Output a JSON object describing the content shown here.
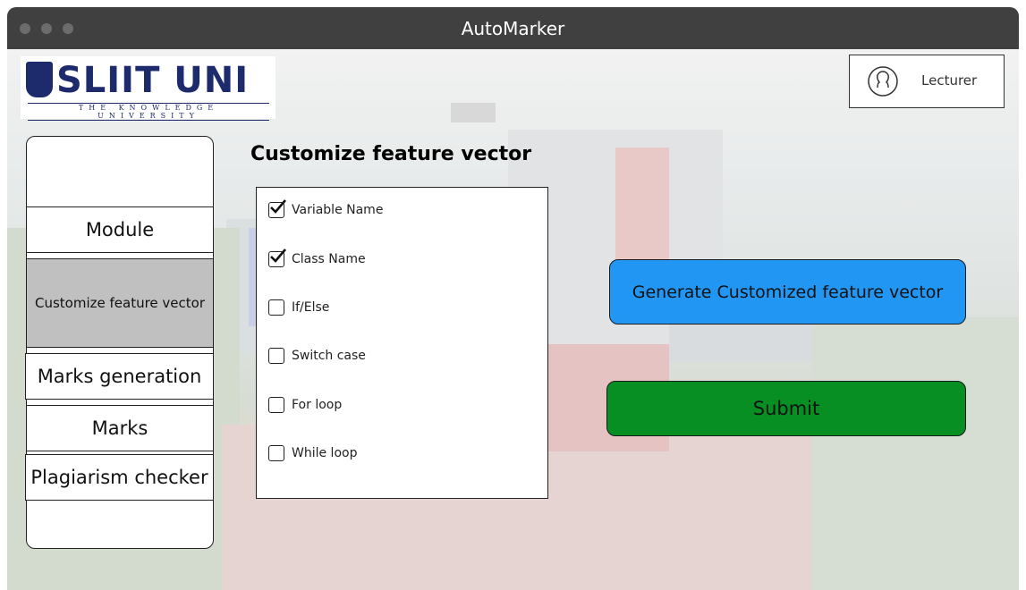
{
  "window": {
    "title": "AutoMarker"
  },
  "logo": {
    "name": "SLIIT UNI",
    "tagline": "THE KNOWLEDGE UNIVERSITY"
  },
  "user": {
    "role": "Lecturer",
    "icon": "user-avatar-icon"
  },
  "sidebar": {
    "items": [
      {
        "label": "Module",
        "active": false
      },
      {
        "label": "Customize feature vector",
        "active": true
      },
      {
        "label": "Marks generation",
        "active": false
      },
      {
        "label": "Marks",
        "active": false
      },
      {
        "label": "Plagiarism checker",
        "active": false
      }
    ]
  },
  "main": {
    "title": "Customize feature vector",
    "features": [
      {
        "label": "Variable Name",
        "checked": true
      },
      {
        "label": "Class Name",
        "checked": true
      },
      {
        "label": "If/Else",
        "checked": false
      },
      {
        "label": "Switch case",
        "checked": false
      },
      {
        "label": "For loop",
        "checked": false
      },
      {
        "label": "While loop",
        "checked": false
      }
    ],
    "generate_label": "Generate Customized feature vector",
    "submit_label": "Submit"
  },
  "colors": {
    "titlebar": "#404040",
    "generate_button": "#2196f3",
    "submit_button": "#078f23",
    "active_sidebar": "#c0c0c0",
    "brand": "#1d2a6b"
  }
}
